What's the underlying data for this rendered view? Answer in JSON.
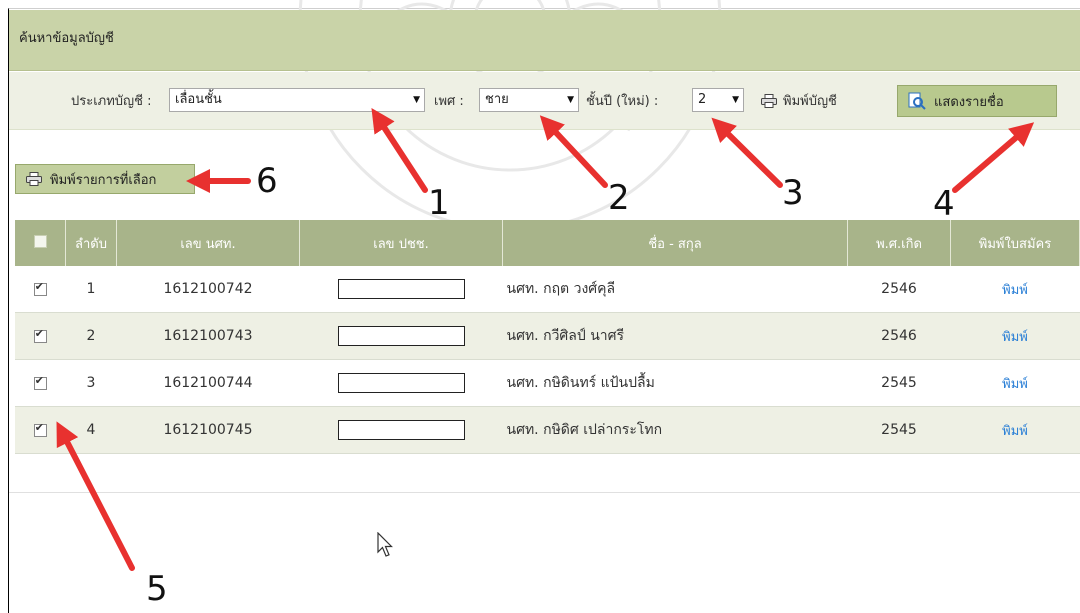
{
  "page": {
    "title": "ค้นหาข้อมูลบัญชี"
  },
  "search": {
    "type_label": "ประเภทบัญชี :",
    "type_value": "เลื่อนชั้น",
    "gender_label": "เพศ :",
    "gender_value": "ชาย",
    "grade_label": "ชั้นปี (ใหม่) :",
    "grade_value": "2",
    "print_account_label": "พิมพ์บัญชี",
    "show_names_label": "แสดงรายชื่อ"
  },
  "toolbar": {
    "print_selected_label": "พิมพ์รายการที่เลือก"
  },
  "table": {
    "headers": [
      "",
      "ลำดับ",
      "เลข นศท.",
      "เลข ปชช.",
      "ชื่อ - สกุล",
      "พ.ศ.เกิด",
      "พิมพ์ใบสมัคร"
    ],
    "rows": [
      {
        "checked": true,
        "no": "1",
        "id": "1612100742",
        "name": "นศท. กฤต  วงศ์คุลี",
        "year": "2546",
        "action": "พิมพ์"
      },
      {
        "checked": true,
        "no": "2",
        "id": "1612100743",
        "name": "นศท. กวีศิลป์  นาศรี",
        "year": "2546",
        "action": "พิมพ์"
      },
      {
        "checked": true,
        "no": "3",
        "id": "1612100744",
        "name": "นศท. กษิดินทร์  แป้นปลื้ม",
        "year": "2545",
        "action": "พิมพ์"
      },
      {
        "checked": true,
        "no": "4",
        "id": "1612100745",
        "name": "นศท. กษิดิศ  เปล่ากระโทก",
        "year": "2545",
        "action": "พิมพ์"
      }
    ]
  },
  "annotations": {
    "labels": [
      "1",
      "2",
      "3",
      "4",
      "5",
      "6"
    ],
    "color": "#e8312f"
  },
  "colors": {
    "header_bg": "#c9d3a8",
    "table_header": "#a8b48a",
    "button_green": "#b8c98e",
    "link": "#2a7fd6"
  }
}
